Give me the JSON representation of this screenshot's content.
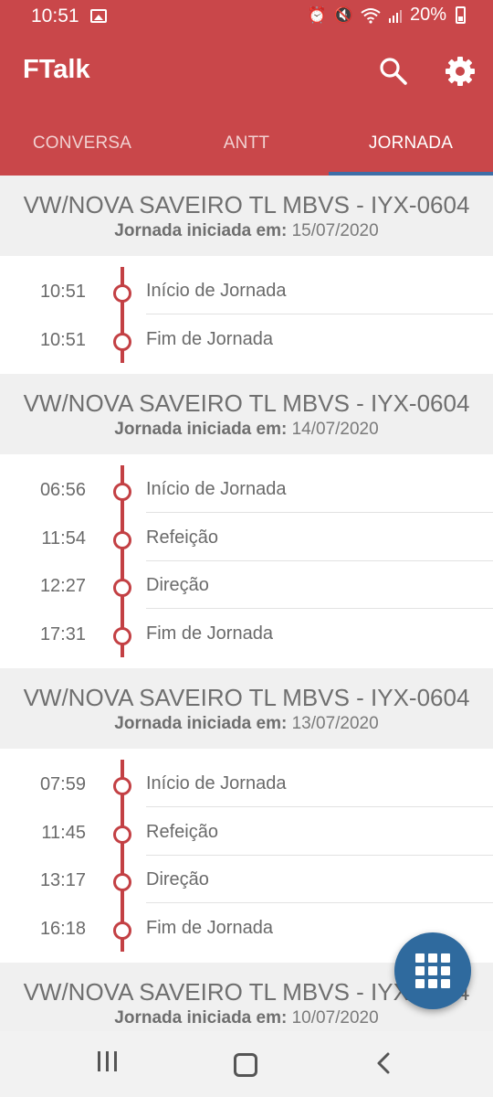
{
  "status_bar": {
    "time": "10:51",
    "battery": "20%",
    "icons": [
      "gallery-icon",
      "alarm-icon",
      "mute-icon",
      "wifi-icon",
      "signal-icon",
      "battery-icon"
    ]
  },
  "app_bar": {
    "title": "FTalk",
    "icons": [
      "search-icon",
      "settings-gear-icon"
    ]
  },
  "tabs": [
    {
      "label": "CONVERSA",
      "active": false
    },
    {
      "label": "ANTT",
      "active": false
    },
    {
      "label": "JORNADA",
      "active": true
    }
  ],
  "colors": {
    "primary": "#c9474a",
    "tab_indicator": "#3e6ea7",
    "timeline": "#c34044",
    "fab": "#2f6a9e"
  },
  "journeys": [
    {
      "vehicle": "VW/NOVA SAVEIRO TL MBVS - IYX-0604",
      "started_label": "Jornada iniciada em:",
      "started_date": "15/07/2020",
      "events": [
        {
          "time": "10:51",
          "label": "Início de Jornada"
        },
        {
          "time": "10:51",
          "label": "Fim de Jornada"
        }
      ]
    },
    {
      "vehicle": "VW/NOVA SAVEIRO TL MBVS - IYX-0604",
      "started_label": "Jornada iniciada em:",
      "started_date": "14/07/2020",
      "events": [
        {
          "time": "06:56",
          "label": "Início de Jornada"
        },
        {
          "time": "11:54",
          "label": "Refeição"
        },
        {
          "time": "12:27",
          "label": "Direção"
        },
        {
          "time": "17:31",
          "label": "Fim de Jornada"
        }
      ]
    },
    {
      "vehicle": "VW/NOVA SAVEIRO TL MBVS - IYX-0604",
      "started_label": "Jornada iniciada em:",
      "started_date": "13/07/2020",
      "events": [
        {
          "time": "07:59",
          "label": "Início de Jornada"
        },
        {
          "time": "11:45",
          "label": "Refeição"
        },
        {
          "time": "13:17",
          "label": "Direção"
        },
        {
          "time": "16:18",
          "label": "Fim de Jornada"
        }
      ]
    },
    {
      "vehicle": "VW/NOVA SAVEIRO TL MBVS - IYX-0604",
      "started_label": "Jornada iniciada em:",
      "started_date": "10/07/2020",
      "events": []
    }
  ],
  "fab": {
    "icon": "grid-menu-icon"
  },
  "nav_bar": {
    "icons": [
      "recent-apps-icon",
      "home-icon",
      "back-icon"
    ]
  }
}
